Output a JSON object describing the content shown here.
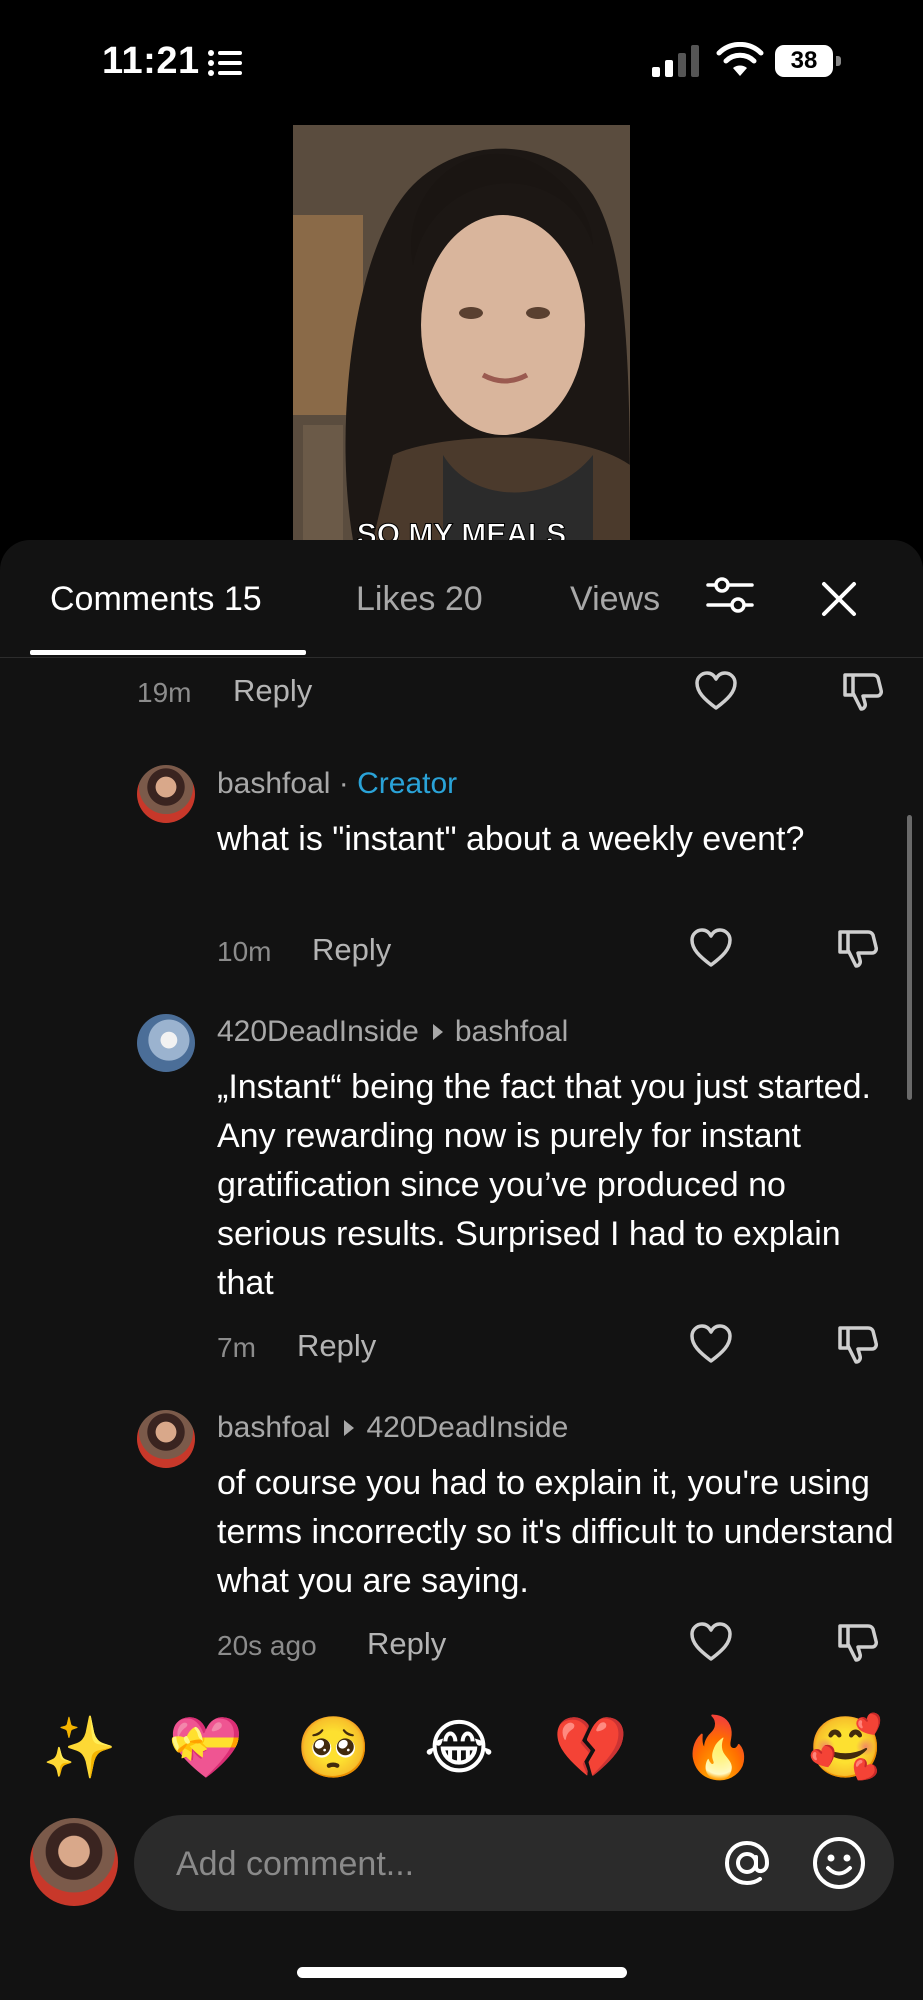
{
  "status_bar": {
    "time": "11:21",
    "battery": "38"
  },
  "video": {
    "caption": "SO MY MEALS"
  },
  "tabs": [
    {
      "label": "Comments 15",
      "active": true
    },
    {
      "label": "Likes 20",
      "active": false
    },
    {
      "label": "Views",
      "active": false
    }
  ],
  "comments": [
    {
      "time": "19m",
      "reply": "Reply"
    },
    {
      "username": "bashfoal",
      "separator": "·",
      "badge": "Creator",
      "text": "what is \"instant\" about a weekly event?",
      "time": "10m",
      "reply": "Reply"
    },
    {
      "username": "420DeadInside",
      "reply_to": "bashfoal",
      "text": "„Instant“ being the fact that you just started. Any rewarding now is purely for instant gratification since you’ve produced no serious results. Surprised I had to explain that",
      "time": "7m",
      "reply": "Reply"
    },
    {
      "username": "bashfoal",
      "reply_to": "420DeadInside",
      "text": "of course you had to explain it, you're using terms incorrectly so it's difficult to understand what you are saying.",
      "time": "20s ago",
      "reply": "Reply"
    }
  ],
  "emoji_bar": [
    "✨",
    "💝",
    "🥺",
    "😂",
    "💔",
    "🔥",
    "🥰"
  ],
  "composer": {
    "placeholder": "Add comment..."
  },
  "colors": {
    "creator": "#2aa3d8",
    "sheet_bg": "#121212"
  }
}
